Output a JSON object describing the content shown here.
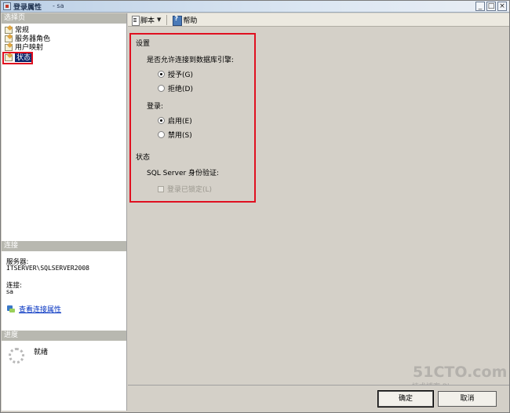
{
  "window": {
    "title": "登录属性",
    "title_suffix": "- sa",
    "controls": [
      "_",
      "□",
      "×"
    ]
  },
  "left_pane": {
    "select_page_header": "选择页",
    "pages": [
      {
        "label": "常规",
        "selected": false
      },
      {
        "label": "服务器角色",
        "selected": false
      },
      {
        "label": "用户映射",
        "selected": false
      },
      {
        "label": "状态",
        "selected": true
      }
    ],
    "connection_header": "连接",
    "server_label": "服务器:",
    "server_value": "ITSERVER\\SQLSERVER2008",
    "connection_label": "连接:",
    "connection_value": "sa",
    "view_connection_link": "查看连接属性",
    "progress_header": "进度",
    "progress_status": "就绪"
  },
  "toolbar": {
    "script_label": "脚本",
    "help_label": "帮助"
  },
  "settings": {
    "section_title": "设置",
    "db_engine_question": "是否允许连接到数据库引擎:",
    "grant_label": "授予(G)",
    "deny_label": "拒绝(D)",
    "grant_selected": true,
    "login_label": "登录:",
    "enabled_label": "启用(E)",
    "disabled_label": "禁用(S)",
    "enabled_selected": true,
    "status_title": "状态",
    "sql_auth_label": "SQL Server 身份验证:",
    "locked_label": "登录已锁定(L)",
    "locked_checked": false
  },
  "buttons": {
    "ok_label": "确定",
    "cancel_label": "取消"
  },
  "watermark": {
    "brand": "51CTO.com",
    "sub": "技术博客 Blog"
  },
  "colors": {
    "highlight_box": "#e01020",
    "selection": "#0a246a",
    "link": "#0030c0"
  }
}
